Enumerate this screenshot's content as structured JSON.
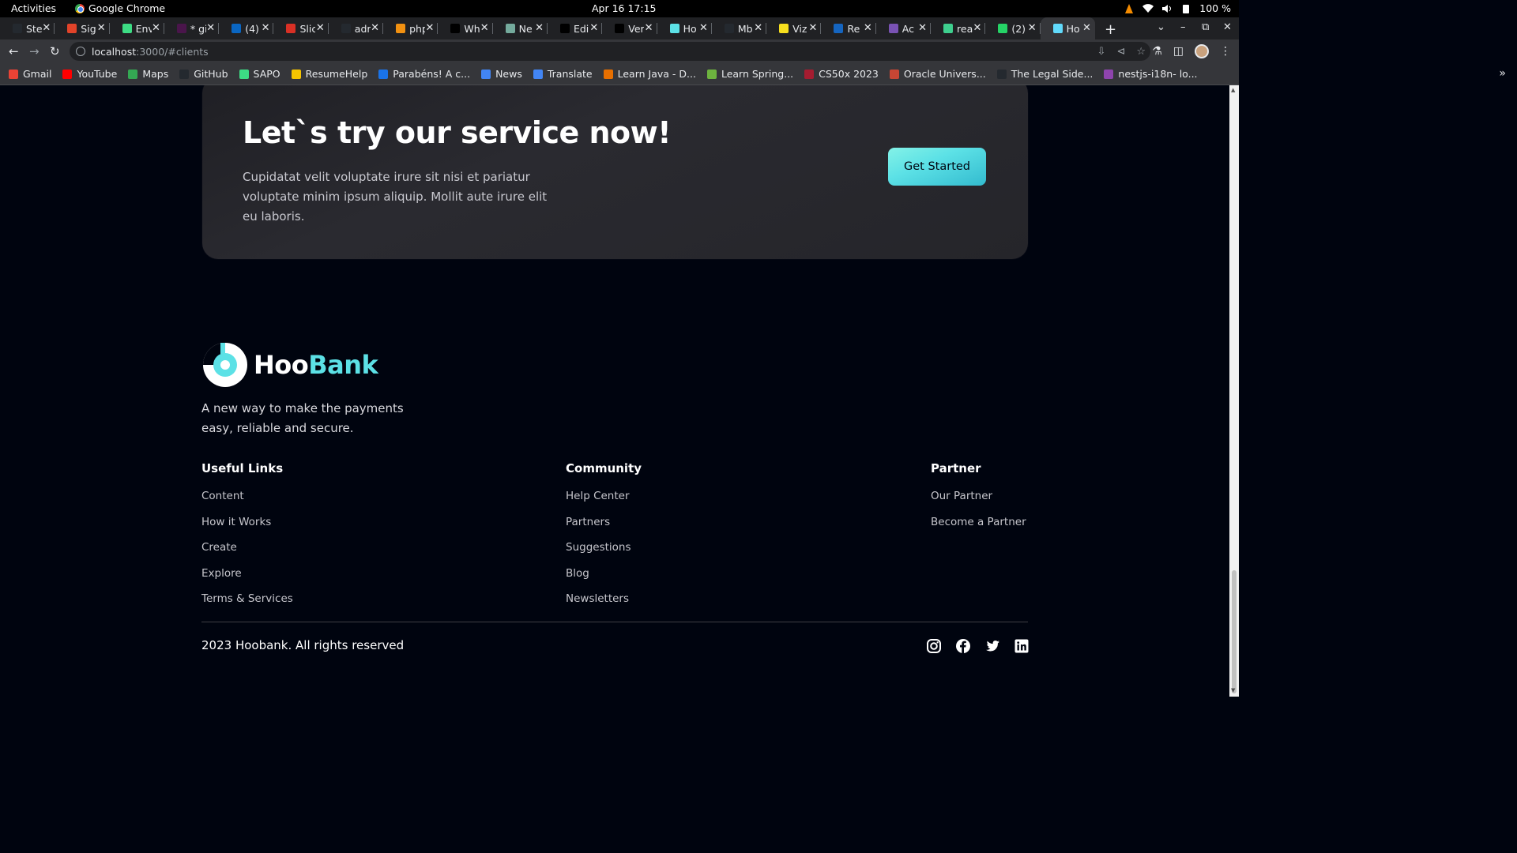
{
  "system_bar": {
    "activities": "Activities",
    "app_name": "Google Chrome",
    "clock": "Apr 16  17:15",
    "battery": "100 %"
  },
  "tabs": [
    {
      "label": "Ste",
      "color": "#24292f",
      "active": false
    },
    {
      "label": "Sig",
      "color": "#e24329",
      "active": false
    },
    {
      "label": "Env",
      "color": "#3ddc84",
      "active": false
    },
    {
      "label": "* gi",
      "color": "#4a154b",
      "active": false
    },
    {
      "label": "(4)",
      "color": "#0a66c2",
      "active": false
    },
    {
      "label": "Slic",
      "color": "#d93025",
      "active": false
    },
    {
      "label": "adr",
      "color": "#24292f",
      "active": false
    },
    {
      "label": "php",
      "color": "#f29111",
      "active": false
    },
    {
      "label": "Wh",
      "color": "#000000",
      "active": false
    },
    {
      "label": "Ne",
      "color": "#74aa9c",
      "active": false
    },
    {
      "label": "Edi",
      "color": "#000000",
      "active": false
    },
    {
      "label": "Ver",
      "color": "#000000",
      "active": false
    },
    {
      "label": "Ho",
      "color": "#5ce1e6",
      "active": false
    },
    {
      "label": "Mb",
      "color": "#24292f",
      "active": false
    },
    {
      "label": "Viz",
      "color": "#f7df1e",
      "active": false
    },
    {
      "label": "Re",
      "color": "#1565c0",
      "active": false
    },
    {
      "label": "Ac",
      "color": "#7952b3",
      "active": false
    },
    {
      "label": "rea",
      "color": "#3ecf8e",
      "active": false
    },
    {
      "label": "(2)",
      "color": "#25d366",
      "active": false
    },
    {
      "label": "Ho",
      "color": "#61dafb",
      "active": true
    }
  ],
  "address_bar": {
    "host": "localhost",
    "path": ":3000/#clients"
  },
  "bookmarks": [
    {
      "label": "Gmail",
      "color": "#ea4335"
    },
    {
      "label": "YouTube",
      "color": "#ff0000"
    },
    {
      "label": "Maps",
      "color": "#34a853"
    },
    {
      "label": "GitHub",
      "color": "#24292f"
    },
    {
      "label": "SAPO",
      "color": "#3ddc84"
    },
    {
      "label": "ResumeHelp",
      "color": "#f5c400"
    },
    {
      "label": "Parabéns! A c...",
      "color": "#1a73e8"
    },
    {
      "label": "News",
      "color": "#4285f4"
    },
    {
      "label": "Translate",
      "color": "#4285f4"
    },
    {
      "label": "Learn Java - D...",
      "color": "#e76f00"
    },
    {
      "label": "Learn Spring...",
      "color": "#6db33f"
    },
    {
      "label": "CS50x 2023",
      "color": "#a51c30"
    },
    {
      "label": "Oracle Univers...",
      "color": "#c74634"
    },
    {
      "label": "The Legal Side...",
      "color": "#24292f"
    },
    {
      "label": "nestjs-i18n- lo...",
      "color": "#8e44ad"
    }
  ],
  "cta": {
    "title": "Let`s try our service now!",
    "text": "Cupidatat velit voluptate irure sit nisi et pariatur voluptate minim ipsum aliquip. Mollit aute irure elit eu laboris.",
    "button": "Get Started"
  },
  "footer": {
    "logo_left": "Hoo",
    "logo_right": "Bank",
    "tagline": "A new way to make the payments easy, reliable and secure.",
    "columns": [
      {
        "title": "Useful Links",
        "links": [
          "Content",
          "How it Works",
          "Create",
          "Explore",
          "Terms & Services"
        ]
      },
      {
        "title": "Community",
        "links": [
          "Help Center",
          "Partners",
          "Suggestions",
          "Blog",
          "Newsletters"
        ]
      },
      {
        "title": "Partner",
        "links": [
          "Our Partner",
          "Become a Partner"
        ]
      }
    ],
    "copyright": "2023 Hoobank. All rights reserved",
    "socials": [
      "instagram-icon",
      "facebook-icon",
      "twitter-icon",
      "linkedin-icon"
    ]
  },
  "colors": {
    "background": "#00040f",
    "accent": "#5ce1e6",
    "card": "#25252a"
  }
}
